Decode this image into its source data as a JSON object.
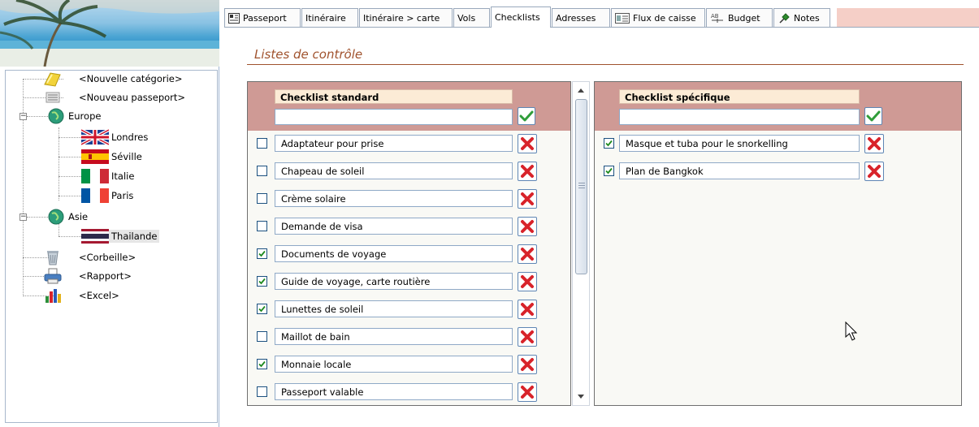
{
  "tabs": [
    {
      "label": "Passeport",
      "icon": "passport-icon"
    },
    {
      "label": "Itinéraire",
      "icon": ""
    },
    {
      "label": "Itinéraire > carte",
      "icon": ""
    },
    {
      "label": "Vols",
      "icon": ""
    },
    {
      "label": "Checklists",
      "icon": "",
      "active": true
    },
    {
      "label": "Adresses",
      "icon": ""
    },
    {
      "label": "Flux de caisse",
      "icon": "cashflow-icon"
    },
    {
      "label": "Budget",
      "icon": "budget-icon"
    },
    {
      "label": "Notes",
      "icon": "pin-icon"
    }
  ],
  "tree": {
    "new_category": "<Nouvelle catégorie>",
    "new_passport": "<Nouveau passeport>",
    "europe": "Europe",
    "europe_items": [
      "Londres",
      "Séville",
      "Italie",
      "Paris"
    ],
    "asia": "Asie",
    "asia_items": [
      "Thailande"
    ],
    "trash": "<Corbeille>",
    "report": "<Rapport>",
    "excel": "<Excel>"
  },
  "main": {
    "title": "Listes de contrôle"
  },
  "standard": {
    "header": "Checklist standard",
    "new_value": "",
    "items": [
      {
        "label": "Adaptateur pour prise",
        "checked": false
      },
      {
        "label": "Chapeau de soleil",
        "checked": false
      },
      {
        "label": "Crème solaire",
        "checked": false
      },
      {
        "label": "Demande de visa",
        "checked": false
      },
      {
        "label": "Documents de voyage",
        "checked": true
      },
      {
        "label": "Guide de voyage, carte routière",
        "checked": true
      },
      {
        "label": "Lunettes de soleil",
        "checked": true
      },
      {
        "label": "Maillot de bain",
        "checked": false
      },
      {
        "label": "Monnaie locale",
        "checked": true
      },
      {
        "label": "Passeport valable",
        "checked": false
      }
    ]
  },
  "specific": {
    "header": "Checklist spécifique",
    "new_value": "",
    "items": [
      {
        "label": "Masque et tuba pour le snorkelling",
        "checked": true
      },
      {
        "label": "Plan de Bangkok",
        "checked": true
      }
    ]
  },
  "colors": {
    "header_band": "#cf9a95",
    "header_label_bg": "#fcebd6",
    "title": "#a0522d",
    "delete_red": "#d8232a",
    "ok_green": "#2f9d3a"
  }
}
